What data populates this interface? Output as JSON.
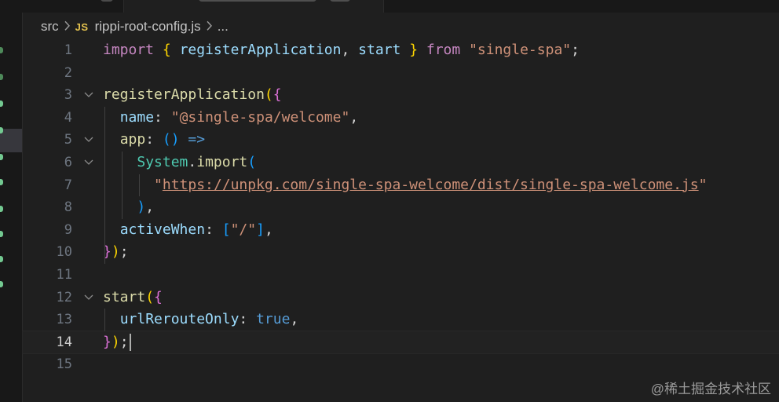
{
  "breadcrumb": {
    "folder": "src",
    "file_icon": "JS",
    "file": "rippi-root-config.js",
    "more": "..."
  },
  "editor": {
    "current_line": 14,
    "lines": [
      {
        "n": "1",
        "tokens": [
          [
            "kw",
            "import"
          ],
          [
            "pl",
            " "
          ],
          [
            "b1",
            "{"
          ],
          [
            "pl",
            " "
          ],
          [
            "vv",
            "registerApplication"
          ],
          [
            "pl",
            ", "
          ],
          [
            "vv",
            "start"
          ],
          [
            "pl",
            " "
          ],
          [
            "b1",
            "}"
          ],
          [
            "pl",
            " "
          ],
          [
            "kw",
            "from"
          ],
          [
            "pl",
            " "
          ],
          [
            "str",
            "\"single-spa\""
          ],
          [
            "pl",
            ";"
          ]
        ]
      },
      {
        "n": "2",
        "tokens": []
      },
      {
        "n": "3",
        "tokens": [
          [
            "fn",
            "registerApplication"
          ],
          [
            "b1",
            "("
          ],
          [
            "b2",
            "{"
          ]
        ]
      },
      {
        "n": "4",
        "tokens": [
          [
            "pl",
            "  "
          ],
          [
            "vv",
            "name"
          ],
          [
            "pl",
            ": "
          ],
          [
            "str",
            "\"@single-spa/welcome\""
          ],
          [
            "pl",
            ","
          ]
        ]
      },
      {
        "n": "5",
        "tokens": [
          [
            "pl",
            "  "
          ],
          [
            "fn",
            "app"
          ],
          [
            "pl",
            ": "
          ],
          [
            "b3",
            "()"
          ],
          [
            "pl",
            " "
          ],
          [
            "bool",
            "=>"
          ]
        ]
      },
      {
        "n": "6",
        "tokens": [
          [
            "pl",
            "    "
          ],
          [
            "cls",
            "System"
          ],
          [
            "pl",
            "."
          ],
          [
            "fn",
            "import"
          ],
          [
            "b3",
            "("
          ]
        ]
      },
      {
        "n": "7",
        "tokens": [
          [
            "pl",
            "      "
          ],
          [
            "str",
            "\""
          ],
          [
            "url",
            "https://unpkg.com/single-spa-welcome/dist/single-spa-welcome.js"
          ],
          [
            "str",
            "\""
          ]
        ]
      },
      {
        "n": "8",
        "tokens": [
          [
            "pl",
            "    "
          ],
          [
            "b3",
            ")"
          ],
          [
            "pl",
            ","
          ]
        ]
      },
      {
        "n": "9",
        "tokens": [
          [
            "pl",
            "  "
          ],
          [
            "vv",
            "activeWhen"
          ],
          [
            "pl",
            ": "
          ],
          [
            "b3",
            "["
          ],
          [
            "str",
            "\"/\""
          ],
          [
            "b3",
            "]"
          ],
          [
            "pl",
            ","
          ]
        ]
      },
      {
        "n": "10",
        "tokens": [
          [
            "b2",
            "}"
          ],
          [
            "b1",
            ")"
          ],
          [
            "pl",
            ";"
          ]
        ]
      },
      {
        "n": "11",
        "tokens": []
      },
      {
        "n": "12",
        "tokens": [
          [
            "fn",
            "start"
          ],
          [
            "b1",
            "("
          ],
          [
            "b2",
            "{"
          ]
        ]
      },
      {
        "n": "13",
        "tokens": [
          [
            "pl",
            "  "
          ],
          [
            "vv",
            "urlRerouteOnly"
          ],
          [
            "pl",
            ": "
          ],
          [
            "bool",
            "true"
          ],
          [
            "pl",
            ","
          ]
        ]
      },
      {
        "n": "14",
        "tokens": [
          [
            "b2",
            "}"
          ],
          [
            "b1",
            ")"
          ],
          [
            "pl",
            ";"
          ]
        ]
      },
      {
        "n": "15",
        "tokens": []
      }
    ],
    "fold_lines": [
      "3",
      "5",
      "6",
      "12"
    ]
  },
  "colors": {
    "background": "#1f1f1f",
    "keyword": "#c586c0",
    "variable": "#9cdcfe",
    "function": "#dcdcaa",
    "string": "#ce9178",
    "bracket_level1": "#ffd700",
    "bracket_level2": "#da70d6",
    "bracket_level3": "#179fff",
    "class": "#4ec9b0",
    "boolean": "#569cd6"
  },
  "icons": [
    "chevron-right-icon",
    "js-file-icon",
    "fold-chevron-down-icon"
  ],
  "watermark": "@稀土掘金技术社区"
}
